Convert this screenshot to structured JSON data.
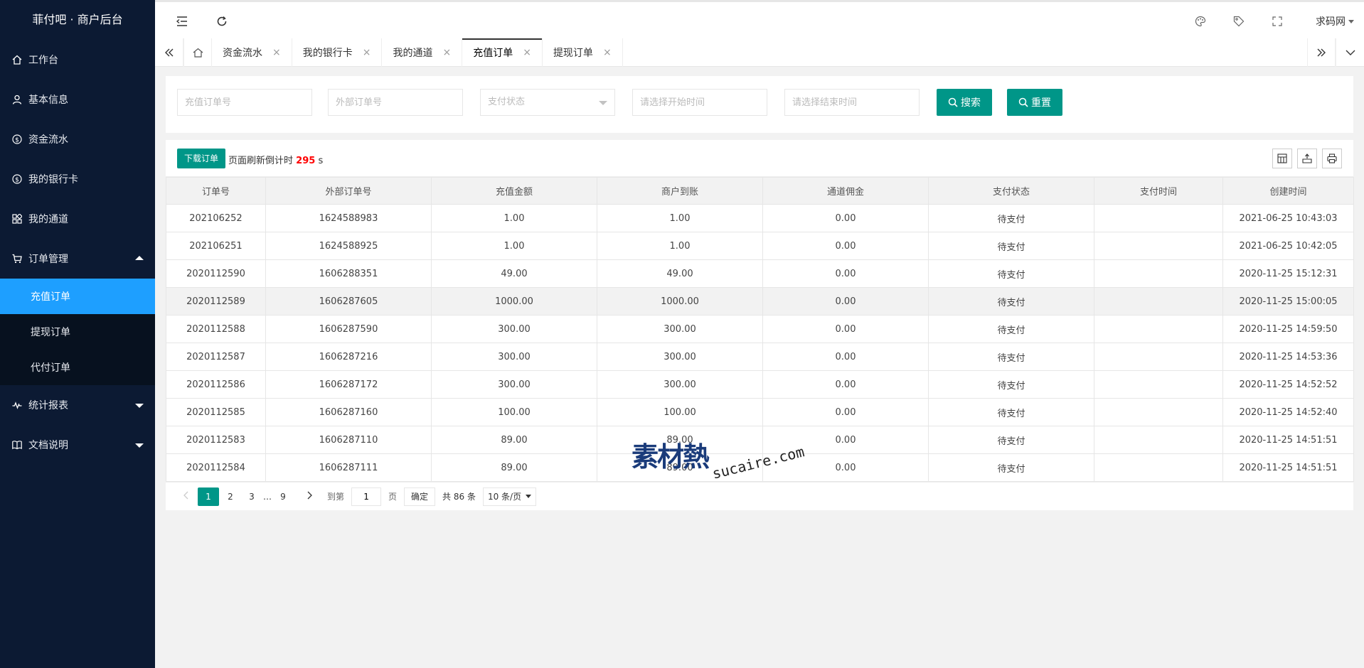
{
  "app": {
    "title": "菲付吧 · 商户后台"
  },
  "sidebar": {
    "items": [
      {
        "label": "工作台"
      },
      {
        "label": "基本信息"
      },
      {
        "label": "资金流水"
      },
      {
        "label": "我的银行卡"
      },
      {
        "label": "我的通道"
      },
      {
        "label": "订单管理"
      },
      {
        "label": "统计报表"
      },
      {
        "label": "文档说明"
      }
    ],
    "subitems": [
      {
        "label": "充值订单"
      },
      {
        "label": "提现订单"
      },
      {
        "label": "代付订单"
      }
    ]
  },
  "header": {
    "user": "求码网"
  },
  "tabs": [
    {
      "label": "资金流水"
    },
    {
      "label": "我的银行卡"
    },
    {
      "label": "我的通道"
    },
    {
      "label": "充值订单"
    },
    {
      "label": "提现订单"
    }
  ],
  "search": {
    "order_no_placeholder": "充值订单号",
    "ext_order_placeholder": "外部订单号",
    "pay_status_placeholder": "支付状态",
    "start_time_placeholder": "请选择开始时间",
    "end_time_placeholder": "请选择结束时间",
    "search_label": "搜索",
    "reset_label": "重置"
  },
  "toolbar": {
    "download_label": "下载订单",
    "refresh_prefix": "页面刷新倒计时",
    "refresh_count": "295",
    "refresh_suffix": "s"
  },
  "table": {
    "columns": [
      "订单号",
      "外部订单号",
      "充值金额",
      "商户到账",
      "通道佣金",
      "支付状态",
      "支付时间",
      "创建时间"
    ],
    "rows": [
      [
        "202106252",
        "1624588983",
        "1.00",
        "1.00",
        "0.00",
        "待支付",
        "",
        "2021-06-25 10:43:03"
      ],
      [
        "202106251",
        "1624588925",
        "1.00",
        "1.00",
        "0.00",
        "待支付",
        "",
        "2021-06-25 10:42:05"
      ],
      [
        "2020112590",
        "1606288351",
        "49.00",
        "49.00",
        "0.00",
        "待支付",
        "",
        "2020-11-25 15:12:31"
      ],
      [
        "2020112589",
        "1606287605",
        "1000.00",
        "1000.00",
        "0.00",
        "待支付",
        "",
        "2020-11-25 15:00:05"
      ],
      [
        "2020112588",
        "1606287590",
        "300.00",
        "300.00",
        "0.00",
        "待支付",
        "",
        "2020-11-25 14:59:50"
      ],
      [
        "2020112587",
        "1606287216",
        "300.00",
        "300.00",
        "0.00",
        "待支付",
        "",
        "2020-11-25 14:53:36"
      ],
      [
        "2020112586",
        "1606287172",
        "300.00",
        "300.00",
        "0.00",
        "待支付",
        "",
        "2020-11-25 14:52:52"
      ],
      [
        "2020112585",
        "1606287160",
        "100.00",
        "100.00",
        "0.00",
        "待支付",
        "",
        "2020-11-25 14:52:40"
      ],
      [
        "2020112583",
        "1606287110",
        "89.00",
        "89.00",
        "0.00",
        "待支付",
        "",
        "2020-11-25 14:51:51"
      ],
      [
        "2020112584",
        "1606287111",
        "89.00",
        "89.00",
        "0.00",
        "待支付",
        "",
        "2020-11-25 14:51:51"
      ]
    ]
  },
  "pager": {
    "pages": [
      "1",
      "2",
      "3"
    ],
    "ellipsis": "…",
    "last_page": "9",
    "goto_label": "到第",
    "goto_value": "1",
    "page_unit": "页",
    "ok_label": "确定",
    "total_label": "共 86 条",
    "limit_label": "10 条/页"
  },
  "watermark": {
    "logo": "素材熱",
    "text": "sucaire.com"
  },
  "colors": {
    "sidebar_bg": "#0c1a33",
    "active": "#1e9fff",
    "primary": "#009688",
    "countdown": "#ff0000"
  }
}
